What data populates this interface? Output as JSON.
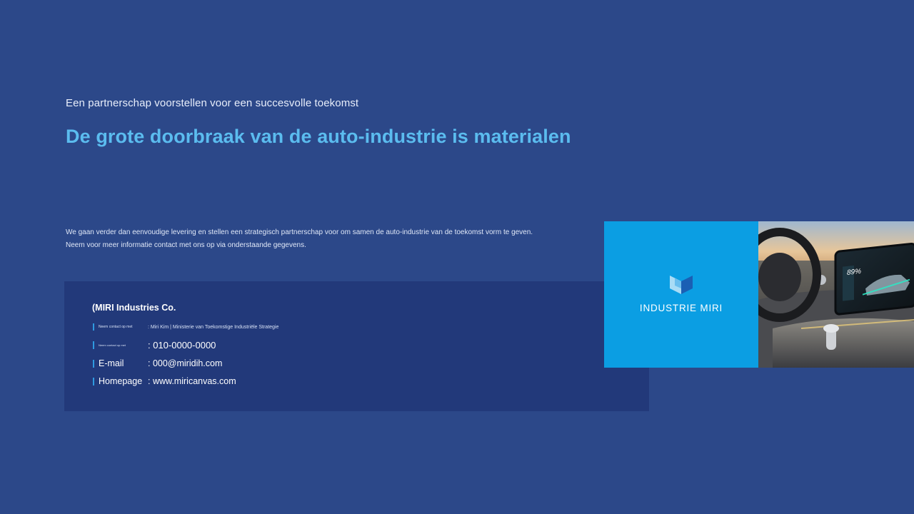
{
  "slide": {
    "subtitle": "Een partnerschap voorstellen voor een succesvolle toekomst",
    "headline": "De grote doorbraak van de auto-industrie is materialen",
    "intro_lines": [
      "We gaan verder dan eenvoudige levering en stellen een strategisch partnerschap voor om samen de auto-industrie van de toekomst vorm te geven.",
      "Neem voor meer informatie contact met ons op via onderstaande gegevens."
    ]
  },
  "contact": {
    "company": "(MIRI Industries Co.",
    "rows": [
      {
        "label": "Neem contact op met",
        "value": ": Miri Kim | Ministerie van Toekomstige Industriële Strategie"
      },
      {
        "label": "Neem contact op met",
        "value": ": 010-0000-0000"
      },
      {
        "label": "E-mail",
        "value": ": 000@miridih.com"
      },
      {
        "label": "Homepage",
        "value": ": www.miricanvas.com"
      }
    ]
  },
  "brand": {
    "name": "INDUSTRIE MIRI",
    "logo_icon": "miri-logo-icon",
    "tile_color": "#0b9ee3"
  },
  "photo": {
    "screen_readout": "89%",
    "depicts": "car-interior-photo"
  },
  "colors": {
    "background": "#2c4889",
    "panel": "#22397a",
    "accent": "#5bbcef",
    "marker": "#2f9ae0"
  }
}
